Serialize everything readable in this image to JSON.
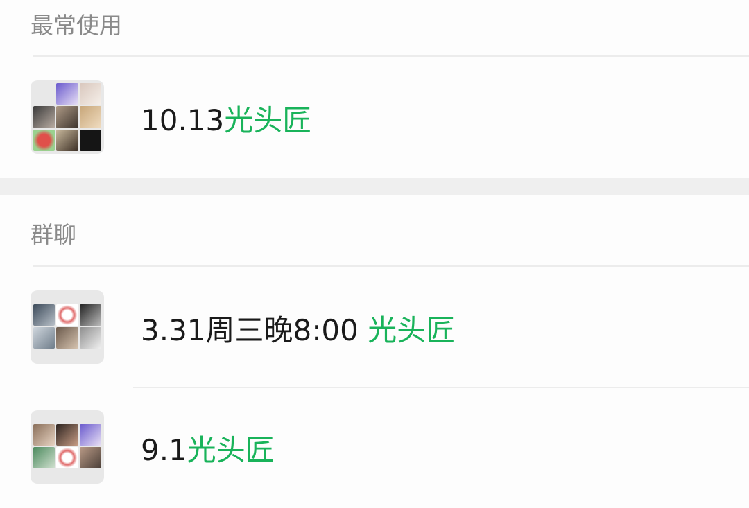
{
  "sections": {
    "frequent": {
      "header": "最常使用",
      "items": [
        {
          "prefix": "10.13",
          "highlight": "光头匠"
        }
      ]
    },
    "groups": {
      "header": "群聊",
      "items": [
        {
          "prefix": "3.31周三晚8:00 ",
          "highlight": "光头匠"
        },
        {
          "prefix": "9.1",
          "highlight": "光头匠"
        }
      ]
    }
  },
  "colors": {
    "highlight": "#19b35a",
    "section_header": "#8a8a8a",
    "divider": "#ececec",
    "gap_band": "#efefef"
  }
}
